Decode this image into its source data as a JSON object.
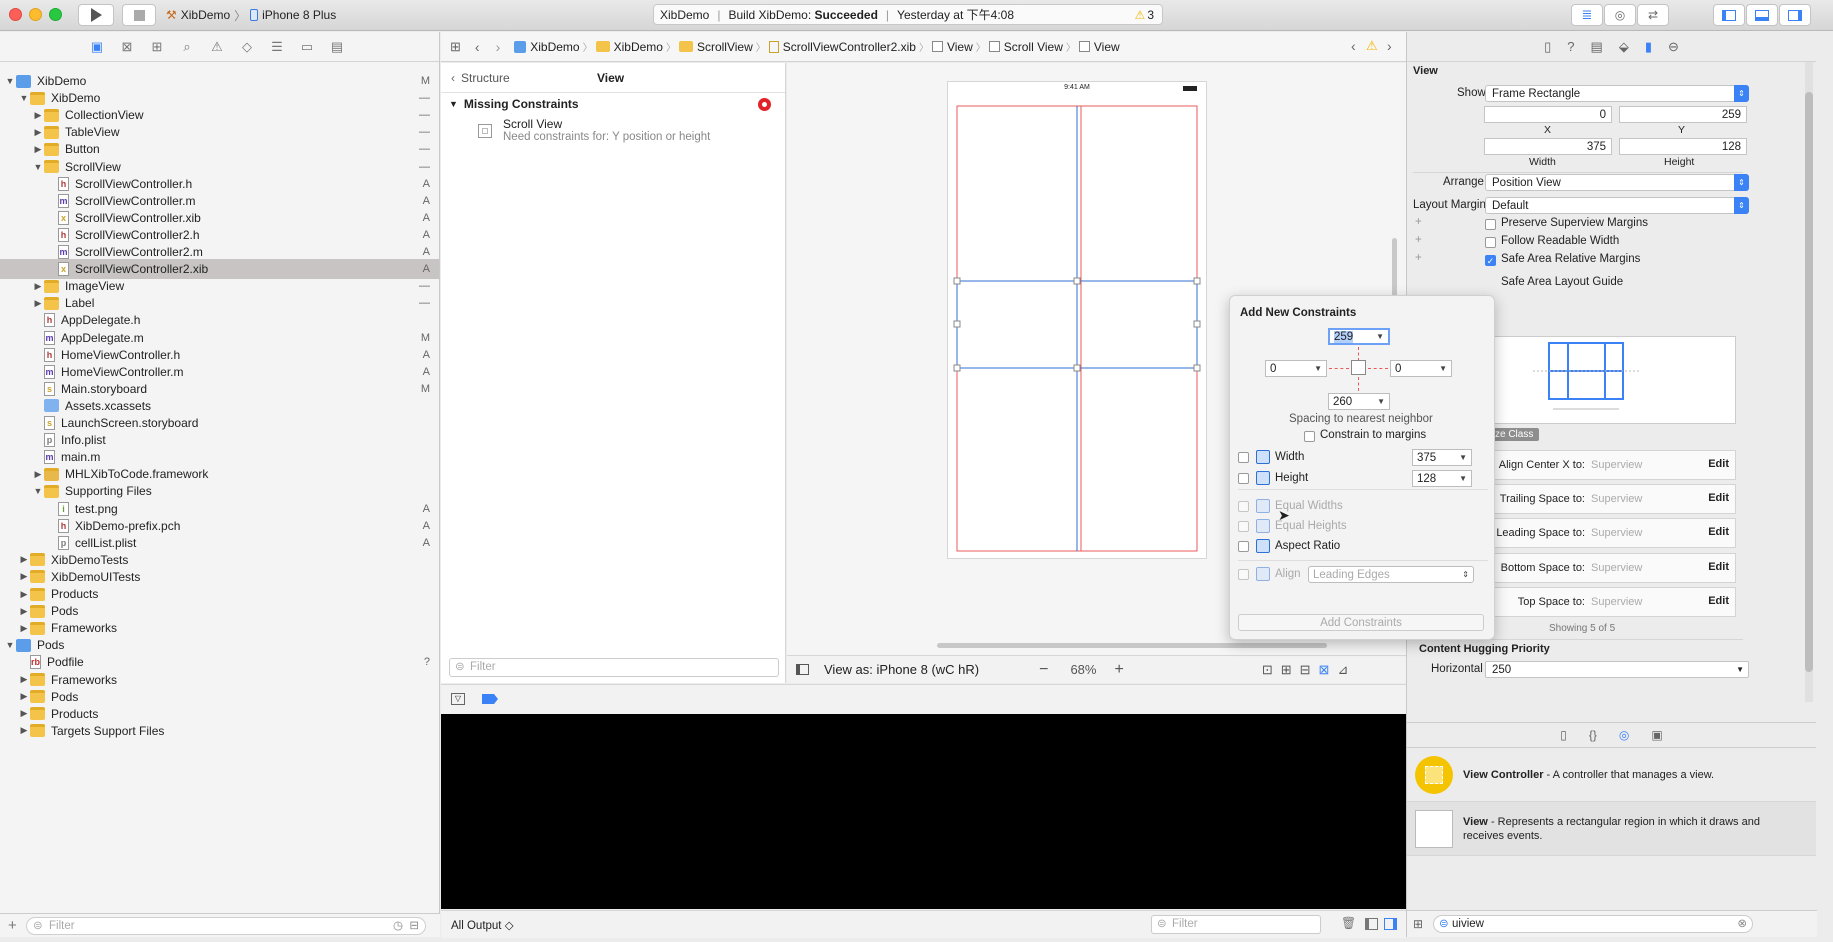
{
  "titlebar": {
    "scheme_name": "XibDemo",
    "device_name": "iPhone 8 Plus",
    "status_project": "XibDemo",
    "status_build_prefix": "Build XibDemo:",
    "status_build_result": "Succeeded",
    "status_time": "Yesterday at 下午4:08",
    "warning_count": "3"
  },
  "navigator": {
    "rows": [
      {
        "label": "XibDemo",
        "depth": 0,
        "open": true,
        "kind": "project",
        "badge": "M"
      },
      {
        "label": "XibDemo",
        "depth": 1,
        "open": true,
        "kind": "folder",
        "badge": "—"
      },
      {
        "label": "CollectionView",
        "depth": 2,
        "open": false,
        "kind": "folder",
        "badge": "—"
      },
      {
        "label": "TableView",
        "depth": 2,
        "open": false,
        "kind": "folder",
        "badge": "—"
      },
      {
        "label": "Button",
        "depth": 2,
        "open": false,
        "kind": "folder",
        "badge": "—"
      },
      {
        "label": "ScrollView",
        "depth": 2,
        "open": true,
        "kind": "folder",
        "badge": "—"
      },
      {
        "label": "ScrollViewController.h",
        "depth": 3,
        "kind": "h",
        "badge": "A"
      },
      {
        "label": "ScrollViewController.m",
        "depth": 3,
        "kind": "m",
        "badge": "A"
      },
      {
        "label": "ScrollViewController.xib",
        "depth": 3,
        "kind": "xib",
        "badge": "A"
      },
      {
        "label": "ScrollViewController2.h",
        "depth": 3,
        "kind": "h",
        "badge": "A"
      },
      {
        "label": "ScrollViewController2.m",
        "depth": 3,
        "kind": "m",
        "badge": "A"
      },
      {
        "label": "ScrollViewController2.xib",
        "depth": 3,
        "kind": "xib",
        "badge": "A",
        "selected": true
      },
      {
        "label": "ImageView",
        "depth": 2,
        "open": false,
        "kind": "folder",
        "badge": "—"
      },
      {
        "label": "Label",
        "depth": 2,
        "open": false,
        "kind": "folder",
        "badge": "—"
      },
      {
        "label": "AppDelegate.h",
        "depth": 2,
        "kind": "h",
        "badge": ""
      },
      {
        "label": "AppDelegate.m",
        "depth": 2,
        "kind": "m",
        "badge": "M"
      },
      {
        "label": "HomeViewController.h",
        "depth": 2,
        "kind": "h",
        "badge": "A"
      },
      {
        "label": "HomeViewController.m",
        "depth": 2,
        "kind": "m",
        "badge": "A"
      },
      {
        "label": "Main.storyboard",
        "depth": 2,
        "kind": "sb",
        "badge": "M"
      },
      {
        "label": "Assets.xcassets",
        "depth": 2,
        "kind": "assets",
        "badge": ""
      },
      {
        "label": "LaunchScreen.storyboard",
        "depth": 2,
        "kind": "sb",
        "badge": ""
      },
      {
        "label": "Info.plist",
        "depth": 2,
        "kind": "plist",
        "badge": ""
      },
      {
        "label": "main.m",
        "depth": 2,
        "kind": "m",
        "badge": ""
      },
      {
        "label": "MHLXibToCode.framework",
        "depth": 2,
        "open": false,
        "kind": "framework",
        "badge": ""
      },
      {
        "label": "Supporting Files",
        "depth": 2,
        "open": true,
        "kind": "folder",
        "badge": ""
      },
      {
        "label": "test.png",
        "depth": 3,
        "kind": "png",
        "badge": "A"
      },
      {
        "label": "XibDemo-prefix.pch",
        "depth": 3,
        "kind": "h",
        "badge": "A"
      },
      {
        "label": "cellList.plist",
        "depth": 3,
        "kind": "plist",
        "badge": "A"
      },
      {
        "label": "XibDemoTests",
        "depth": 1,
        "open": false,
        "kind": "folder",
        "badge": ""
      },
      {
        "label": "XibDemoUITests",
        "depth": 1,
        "open": false,
        "kind": "folder",
        "badge": ""
      },
      {
        "label": "Products",
        "depth": 1,
        "open": false,
        "kind": "folder",
        "badge": ""
      },
      {
        "label": "Pods",
        "depth": 1,
        "open": false,
        "kind": "folder",
        "badge": ""
      },
      {
        "label": "Frameworks",
        "depth": 1,
        "open": false,
        "kind": "folder",
        "badge": ""
      },
      {
        "label": "Pods",
        "depth": 0,
        "open": true,
        "kind": "project",
        "badge": ""
      },
      {
        "label": "Podfile",
        "depth": 1,
        "kind": "rb",
        "badge": "?"
      },
      {
        "label": "Frameworks",
        "depth": 1,
        "open": false,
        "kind": "folder",
        "badge": ""
      },
      {
        "label": "Pods",
        "depth": 1,
        "open": false,
        "kind": "folder",
        "badge": ""
      },
      {
        "label": "Products",
        "depth": 1,
        "open": false,
        "kind": "folder",
        "badge": ""
      },
      {
        "label": "Targets Support Files",
        "depth": 1,
        "open": false,
        "kind": "folder",
        "badge": ""
      }
    ],
    "filter_placeholder": "Filter"
  },
  "jumpbar": {
    "crumbs": [
      "XibDemo",
      "XibDemo",
      "ScrollView",
      "ScrollViewController2.xib",
      "View",
      "Scroll View",
      "View"
    ]
  },
  "outline": {
    "back_label": "Structure",
    "title": "View",
    "section_title": "Missing Constraints",
    "item_title": "Scroll View",
    "item_subtitle": "Need constraints for: Y position or height",
    "filter_placeholder": "Filter"
  },
  "canvas": {
    "status_time": "9:41 AM",
    "view_as": "View as: iPhone 8 (wC hR)",
    "zoom": "68%"
  },
  "console": {
    "output_label": "All Output ◇",
    "filter_placeholder": "Filter"
  },
  "popover": {
    "title": "Add New Constraints",
    "top_value": "259",
    "left_value": "0",
    "right_value": "0",
    "bottom_value": "260",
    "spacing_label": "Spacing to nearest neighbor",
    "constrain_margins_label": "Constrain to margins",
    "width_label": "Width",
    "width_value": "375",
    "height_label": "Height",
    "height_value": "128",
    "equal_widths_label": "Equal Widths",
    "equal_heights_label": "Equal Heights",
    "aspect_ratio_label": "Aspect Ratio",
    "align_label": "Align",
    "align_value": "Leading Edges",
    "add_button": "Add Constraints"
  },
  "inspector": {
    "section_title": "View",
    "show_label": "Show",
    "show_value": "Frame Rectangle",
    "x_value": "0",
    "y_value": "259",
    "x_label": "X",
    "y_label": "Y",
    "width_value": "375",
    "height_value": "128",
    "width_label": "Width",
    "height_label": "Height",
    "arrange_label": "Arrange",
    "arrange_value": "Position View",
    "layout_margins_label": "Layout Margins",
    "layout_margins_value": "Default",
    "preserve_label": "Preserve Superview Margins",
    "follow_label": "Follow Readable Width",
    "safe_area_margins_label": "Safe Area Relative Margins",
    "safe_area_guide_label": "Safe Area Layout Guide",
    "size_class_label": "ze Class",
    "constraints": [
      {
        "label": "Align Center X to:",
        "target": "Superview",
        "edit": "Edit"
      },
      {
        "label": "Trailing Space to:",
        "target": "Superview",
        "edit": "Edit"
      },
      {
        "label": "Leading Space to:",
        "target": "Superview",
        "edit": "Edit"
      },
      {
        "label": "Bottom Space to:",
        "target": "Superview",
        "edit": "Edit"
      },
      {
        "label": "Top Space to:",
        "target": "Superview",
        "edit": "Edit"
      }
    ],
    "showing_label": "Showing 5 of 5",
    "hugging_title": "Content Hugging Priority",
    "horizontal_label": "Horizontal",
    "horizontal_value": "250"
  },
  "library": {
    "items": [
      {
        "title": "View Controller",
        "desc": "- A controller that manages a view."
      },
      {
        "title": "View",
        "desc": "- Represents a rectangular region in which it draws and receives events."
      }
    ],
    "search_value": "uiview"
  },
  "colors": {
    "accent": "#3b82f6",
    "constraint_red": "#e85a5a",
    "warning": "#f5b400"
  }
}
